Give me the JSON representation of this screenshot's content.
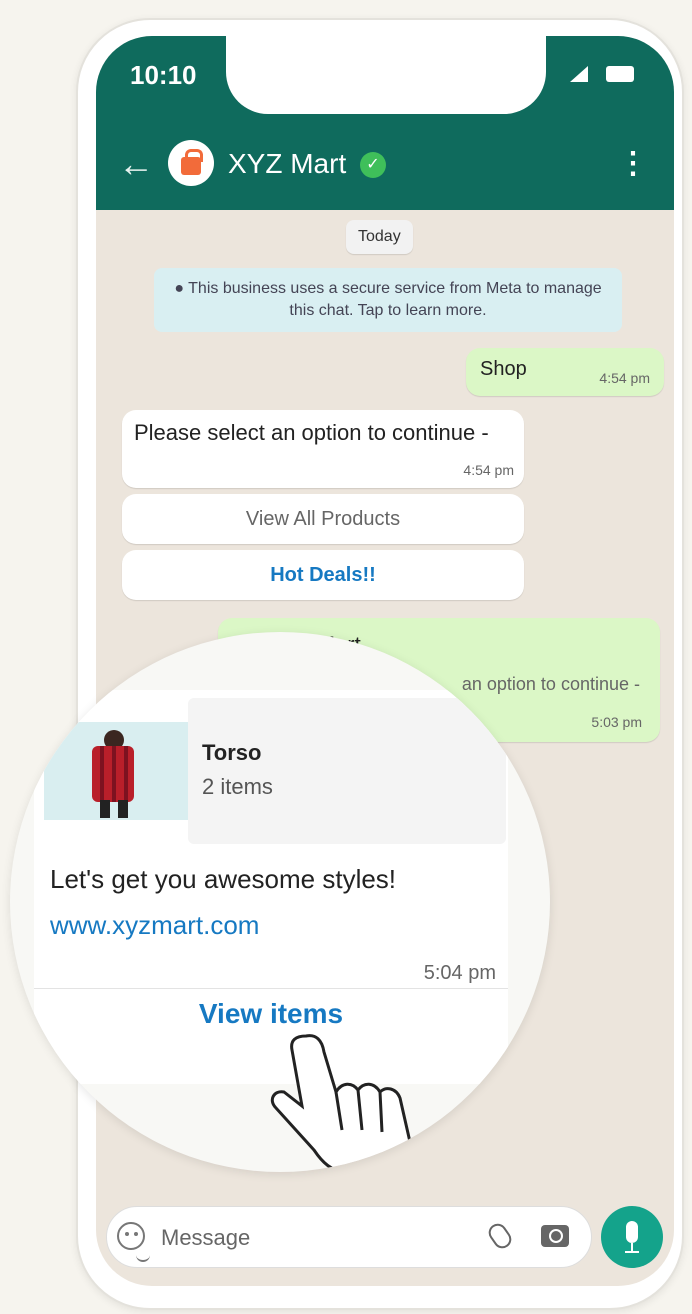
{
  "statusbar": {
    "time": "10:10"
  },
  "chat": {
    "title": "XYZ Mart",
    "date_label": "Today",
    "notice": "This business uses a secure service from Meta to manage this chat. Tap to learn more.",
    "messages": [
      {
        "text": "Shop",
        "time": "4:54 pm"
      },
      {
        "text": "Please select an option to continue -",
        "time": "4:54 pm"
      }
    ],
    "buttons": [
      {
        "label": "View All Products"
      },
      {
        "label": "Hot Deals!!"
      }
    ],
    "reply": {
      "line1": "View All Mart",
      "line2": "an option to continue -",
      "time": "5:03 pm"
    }
  },
  "zoom": {
    "product_title": "Torso",
    "product_sub": "2 items",
    "promo": "Let's get you awesome styles!",
    "url": "www.xyzmart.com",
    "time": "5:04 pm",
    "action": "View items"
  },
  "composer": {
    "placeholder": "Message"
  },
  "colors": {
    "header": "#0f6b5d",
    "accent": "#14a38b",
    "link": "#1679c2",
    "bubble_out": "#dbf7c6"
  },
  "icons": {
    "back": "back-arrow-icon",
    "menu": "more-vertical-icon",
    "verified": "verified-badge-icon",
    "emoji": "emoji-icon",
    "attach": "paperclip-icon",
    "camera": "camera-icon",
    "mic": "microphone-icon"
  }
}
